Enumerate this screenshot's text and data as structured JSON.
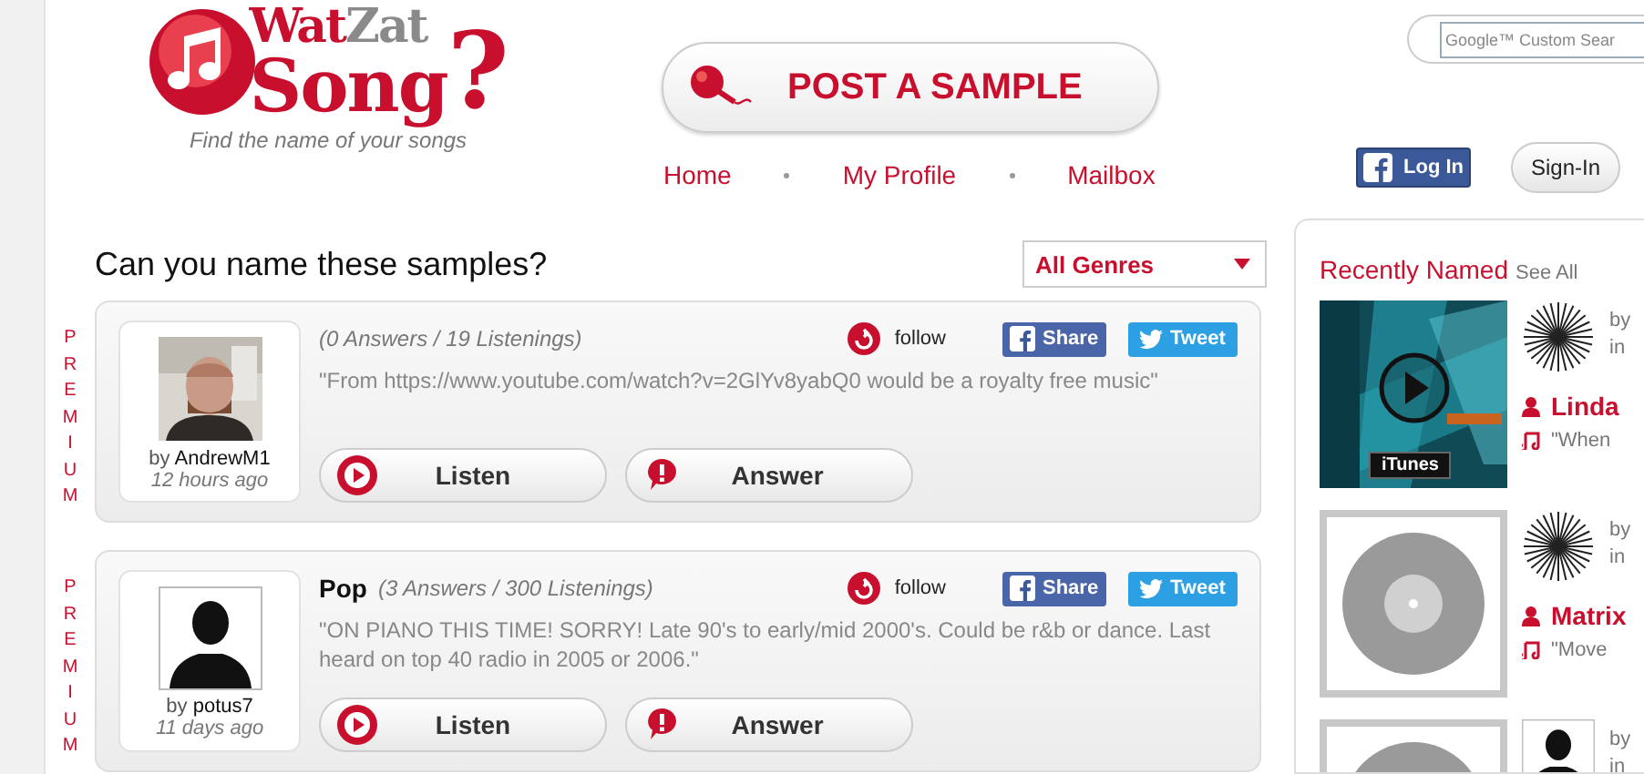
{
  "header": {
    "logo": {
      "word_1": "Wat",
      "word_2": "Zat",
      "word_3": "Song",
      "mark": "?",
      "tagline": "Find the name of your songs"
    },
    "post_button": "POST A SAMPLE",
    "nav": [
      {
        "label": "Home"
      },
      {
        "label": "My Profile"
      },
      {
        "label": "Mailbox"
      }
    ],
    "search": {
      "placeholder": "Google™ Custom Sear"
    },
    "login_button": "Log In",
    "signin_button": "Sign-In"
  },
  "main": {
    "heading": "Can you name these samples?",
    "genre_select": {
      "value": "All Genres"
    },
    "samples": [
      {
        "badge": "PREMIUM",
        "by": "by",
        "user": "AndrewM1",
        "time": "12 hours ago",
        "stats": "(0 Answers / 19 Listenings)",
        "description": "\"From https://www.youtube.com/watch?v=2GlYv8yabQ0 would be a royalty free music\"",
        "follow": "follow",
        "share": "Share",
        "tweet": "Tweet",
        "listen": "Listen",
        "answer": "Answer"
      },
      {
        "badge": "PREMIUM",
        "avatar": {
          "kind": "silhouette"
        },
        "by": "by",
        "user": "potus7",
        "time": "11 days ago",
        "genre": "Pop",
        "stats": "(3 Answers / 300 Listenings)",
        "description": "\"ON PIANO THIS TIME! SORRY! Late 90's to early/mid 2000's. Could be r&b or dance. Last heard on top 40 radio in 2005 or 2006.\"",
        "follow": "follow",
        "share": "Share",
        "tweet": "Tweet",
        "listen": "Listen",
        "answer": "Answer"
      }
    ]
  },
  "sidebar": {
    "title": "Recently Named",
    "see_all": "See All",
    "items": [
      {
        "cover": {
          "kind": "picture",
          "label": "iTunes"
        },
        "avatar": {
          "kind": "burst"
        },
        "by": "by",
        "in": "in",
        "artist": "Linda",
        "song": "\"When"
      },
      {
        "cover": {
          "kind": "record"
        },
        "avatar": {
          "kind": "burst"
        },
        "by": "by",
        "in": "in",
        "artist": "Matrix",
        "song": "\"Move"
      },
      {
        "cover": {
          "kind": "record"
        },
        "avatar": {
          "kind": "silhouette"
        },
        "by": "by",
        "in": "in"
      }
    ]
  }
}
